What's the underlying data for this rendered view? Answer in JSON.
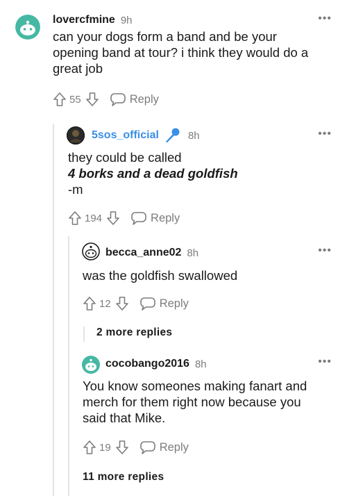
{
  "comments": [
    {
      "username": "lovercfmine",
      "time": "9h",
      "lines": [
        "can your dogs form a band and be your",
        "opening band at tour? i think they would do a",
        "great job"
      ],
      "upvotes": "55",
      "reply_label": "Reply"
    },
    {
      "username": "5sos_official",
      "time": "8h",
      "line1": "they could be called",
      "line2": "4 borks and a dead goldfish",
      "line3": "-m",
      "upvotes": "194",
      "reply_label": "Reply"
    },
    {
      "username": "becca_anne02",
      "time": "8h",
      "lines": [
        "was the goldfish swallowed"
      ],
      "upvotes": "12",
      "reply_label": "Reply",
      "more_replies": "2 more replies"
    },
    {
      "username": "cocobango2016",
      "time": "8h",
      "lines": [
        "You know someones making fanart and",
        "merch for them right now because you",
        "said that Mike."
      ],
      "upvotes": "19",
      "reply_label": "Reply",
      "more_replies": "11 more replies"
    }
  ],
  "more_options_glyph": "•••",
  "colors": {
    "text": "#1a1a1b",
    "meta": "#7c7c7c",
    "official_blue": "#3a8fe6",
    "thread_line": "#e4e4e6",
    "avatar_teal": "#46b8a4"
  }
}
